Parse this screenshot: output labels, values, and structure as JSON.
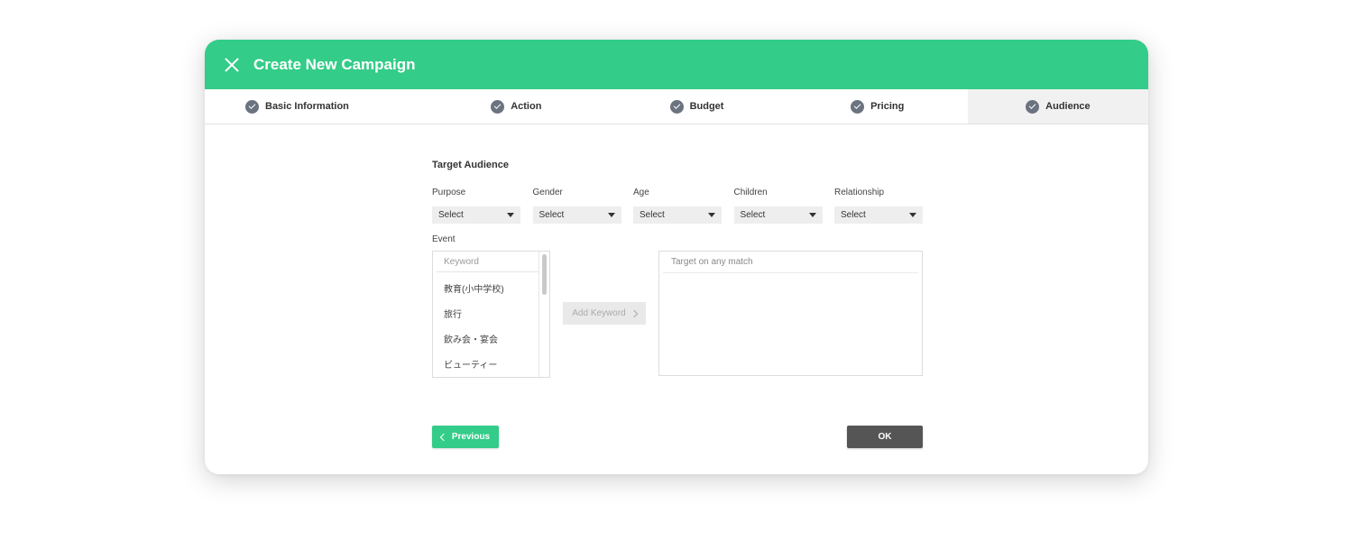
{
  "header": {
    "title": "Create New Campaign",
    "close_icon": "close-icon",
    "color": "#33cc88"
  },
  "steps": [
    {
      "label": "Basic Information",
      "icon": "check-circle-icon",
      "active": false
    },
    {
      "label": "Action",
      "icon": "check-circle-icon",
      "active": false
    },
    {
      "label": "Budget",
      "icon": "check-circle-icon",
      "active": false
    },
    {
      "label": "Pricing",
      "icon": "check-circle-icon",
      "active": false
    },
    {
      "label": "Audience",
      "icon": "check-circle-icon",
      "active": true
    }
  ],
  "target_audience": {
    "title": "Target Audience",
    "fields": [
      {
        "label": "Purpose",
        "value": "Select"
      },
      {
        "label": "Gender",
        "value": "Select"
      },
      {
        "label": "Age",
        "value": "Select"
      },
      {
        "label": "Children",
        "value": "Select"
      },
      {
        "label": "Relationship",
        "value": "Select"
      }
    ]
  },
  "event": {
    "label": "Event",
    "keyword_placeholder": "Keyword",
    "keywords": [
      "教育(小中学校)",
      "旅行",
      "飲み会・宴会",
      "ビューティー"
    ],
    "add_keyword_label": "Add Keyword",
    "target_placeholder": "Target on any match"
  },
  "footer": {
    "previous_label": "Previous",
    "ok_label": "OK"
  },
  "colors": {
    "accent": "#33cc88",
    "ok_button": "#555555",
    "step_icon": "#6b7380"
  }
}
